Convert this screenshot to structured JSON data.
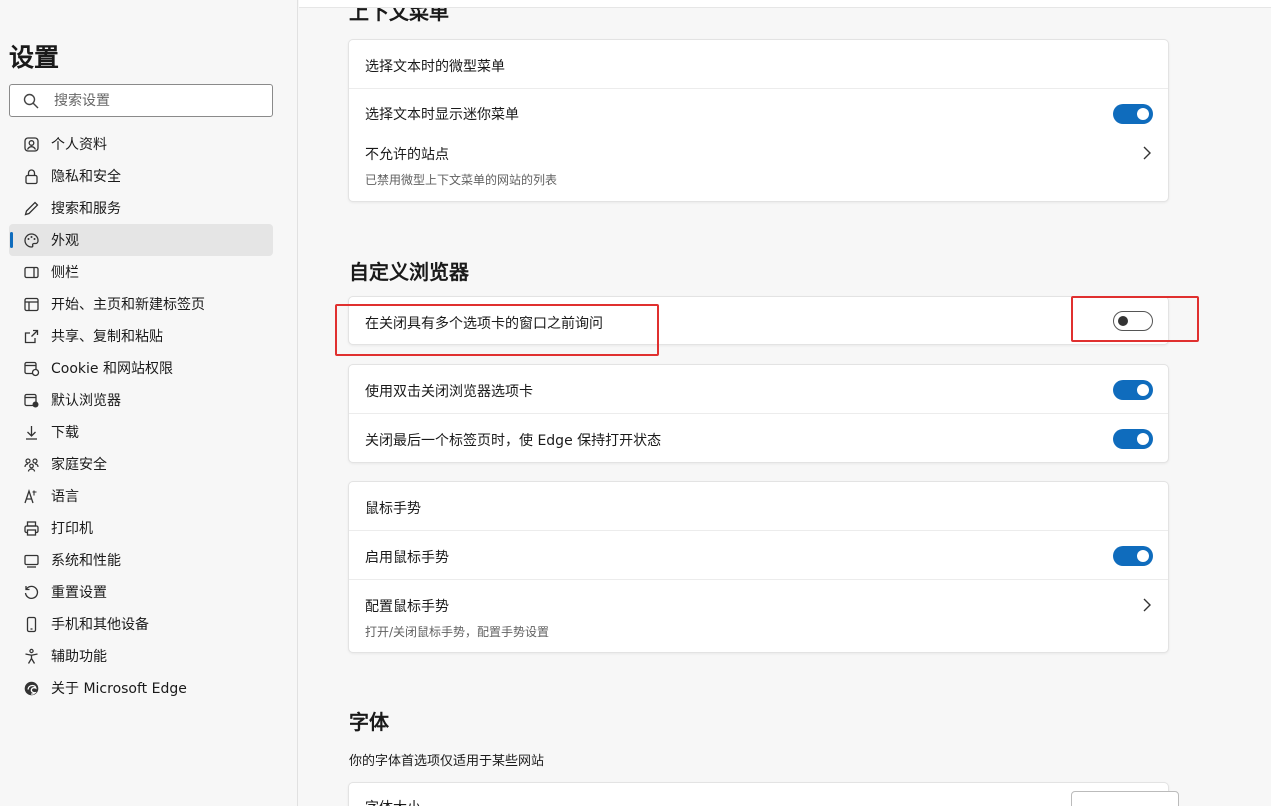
{
  "sidebar": {
    "title": "设置",
    "search_placeholder": "搜索设置",
    "items": [
      {
        "label": "个人资料",
        "icon": "profile-icon"
      },
      {
        "label": "隐私和安全",
        "icon": "lock-icon"
      },
      {
        "label": "搜索和服务",
        "icon": "pen-icon"
      },
      {
        "label": "外观",
        "icon": "palette-icon"
      },
      {
        "label": "侧栏",
        "icon": "sidebar-icon"
      },
      {
        "label": "开始、主页和新建标签页",
        "icon": "home-icon"
      },
      {
        "label": "共享、复制和粘贴",
        "icon": "share-icon"
      },
      {
        "label": "Cookie 和网站权限",
        "icon": "cookie-icon"
      },
      {
        "label": "默认浏览器",
        "icon": "browser-icon"
      },
      {
        "label": "下载",
        "icon": "download-icon"
      },
      {
        "label": "家庭安全",
        "icon": "family-icon"
      },
      {
        "label": "语言",
        "icon": "language-icon"
      },
      {
        "label": "打印机",
        "icon": "printer-icon"
      },
      {
        "label": "系统和性能",
        "icon": "system-icon"
      },
      {
        "label": "重置设置",
        "icon": "reset-icon"
      },
      {
        "label": "手机和其他设备",
        "icon": "phone-icon"
      },
      {
        "label": "辅助功能",
        "icon": "accessibility-icon"
      },
      {
        "label": "关于 Microsoft Edge",
        "icon": "edge-icon"
      }
    ],
    "active_index": 3
  },
  "context_menu": {
    "heading": "上下文菜单",
    "mini_menu_title": "选择文本时的微型菜单",
    "show_mini_menu": "选择文本时显示迷你菜单",
    "show_mini_menu_on": true,
    "disallowed_sites": "不允许的站点",
    "disallowed_sites_desc": "已禁用微型上下文菜单的网站的列表"
  },
  "customize": {
    "heading": "自定义浏览器",
    "ask_before_close": "在关闭具有多个选项卡的窗口之前询问",
    "ask_before_close_on": false,
    "double_click_close": "使用双击关闭浏览器选项卡",
    "double_click_close_on": true,
    "keep_open": "关闭最后一个标签页时，使 Edge 保持打开状态",
    "keep_open_on": true
  },
  "mouse_gesture": {
    "title": "鼠标手势",
    "enable": "启用鼠标手势",
    "enable_on": true,
    "configure": "配置鼠标手势",
    "configure_desc": "打开/关闭鼠标手势，配置手势设置"
  },
  "fonts": {
    "heading": "字体",
    "desc": "你的字体首选项仅适用于某些网站",
    "font_size": "字体大小"
  },
  "colors": {
    "accent": "#0f6cbd",
    "highlight": "#e0302f"
  }
}
